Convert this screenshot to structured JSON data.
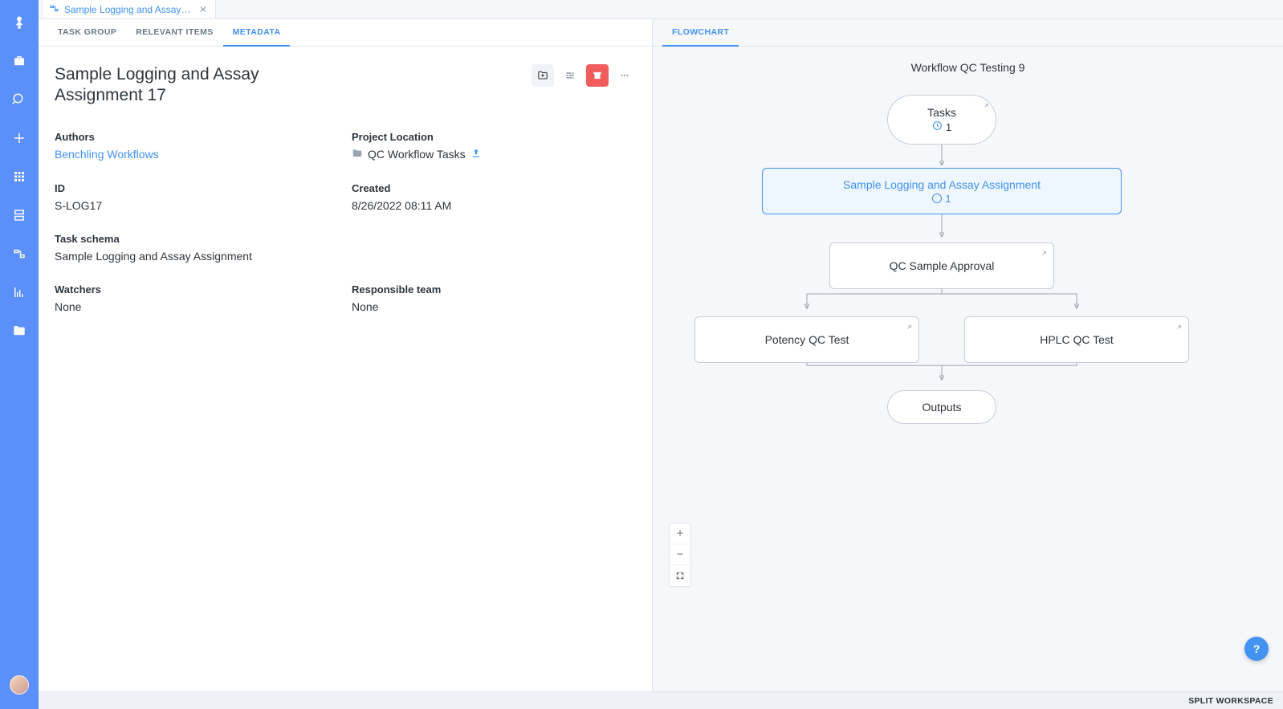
{
  "tab": {
    "label": "Sample Logging and Assay Ass…"
  },
  "left": {
    "tabs": {
      "task_group": "TASK GROUP",
      "relevant_items": "RELEVANT ITEMS",
      "metadata": "METADATA"
    },
    "title": "Sample Logging and Assay Assignment 17",
    "authors_label": "Authors",
    "authors_value": "Benchling Workflows",
    "project_loc_label": "Project Location",
    "project_loc_value": "QC Workflow Tasks",
    "id_label": "ID",
    "id_value": "S-LOG17",
    "created_label": "Created",
    "created_value": "8/26/2022 08:11 AM",
    "task_schema_label": "Task schema",
    "task_schema_value": "Sample Logging and Assay Assignment",
    "watchers_label": "Watchers",
    "watchers_value": "None",
    "team_label": "Responsible team",
    "team_value": "None"
  },
  "right": {
    "tab": "FLOWCHART",
    "title": "Workflow QC Testing 9",
    "nodes": {
      "tasks": {
        "label": "Tasks",
        "count": "1"
      },
      "sample": {
        "label": "Sample Logging and Assay Assignment",
        "count": "1"
      },
      "approval": {
        "label": "QC Sample Approval"
      },
      "potency": {
        "label": "Potency QC Test"
      },
      "hplc": {
        "label": "HPLC QC Test"
      },
      "outputs": {
        "label": "Outputs"
      }
    }
  },
  "footer": {
    "split": "SPLIT WORKSPACE"
  },
  "help": "?"
}
